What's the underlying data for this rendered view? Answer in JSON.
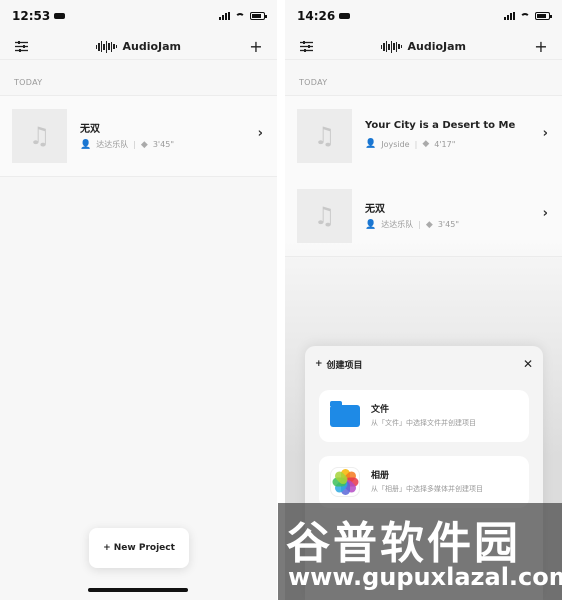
{
  "left_screen": {
    "status_time": "12:53",
    "app_title": "AudioJam",
    "section_label": "TODAY",
    "projects": [
      {
        "title": "无双",
        "artist": "达达乐队",
        "duration": "3'45\""
      }
    ],
    "new_project_label": "+ New Project"
  },
  "right_screen": {
    "status_time": "14:26",
    "app_title": "AudioJam",
    "section_label": "TODAY",
    "projects": [
      {
        "title": "Your City is a Desert to Me",
        "artist": "Joyside",
        "duration": "4'17\""
      },
      {
        "title": "无双",
        "artist": "达达乐队",
        "duration": "3'45\""
      }
    ],
    "sheet": {
      "title": "创建项目",
      "options": [
        {
          "title": "文件",
          "subtitle": "从「文件」中选择文件并创建项目",
          "icon": "files-app-icon"
        },
        {
          "title": "相册",
          "subtitle": "从「相册」中选择多媒体并创建项目",
          "icon": "photos-app-icon"
        }
      ]
    }
  },
  "watermark": {
    "text_cn": "谷普软件园",
    "text_url": "www.gupuxlazal.com"
  },
  "colors": {
    "accent_blue": "#1e8ae6",
    "watermark_green": "#7cc443"
  }
}
